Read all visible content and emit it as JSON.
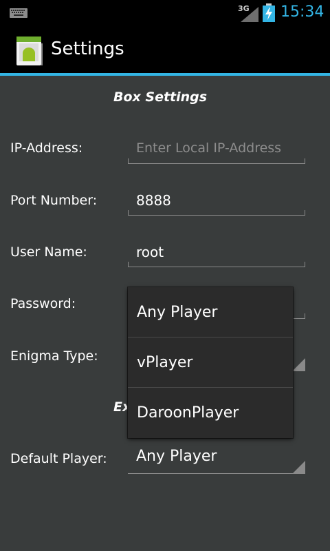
{
  "status_bar": {
    "network": "3G",
    "time": "15:34",
    "icons": [
      "keyboard-icon",
      "signal-icon",
      "battery-charging-icon"
    ]
  },
  "action_bar": {
    "title": "Settings",
    "icon": "android-app-icon"
  },
  "box_settings": {
    "title": "Box Settings",
    "ip_label": "IP-Address:",
    "ip_placeholder": "Enter Local IP-Address",
    "port_label": "Port Number:",
    "port_value": "8888",
    "user_label": "User Name:",
    "user_value": "root",
    "password_label": "Password:",
    "enigma_label": "Enigma Type:"
  },
  "extra_settings": {
    "title_visible": "Ex",
    "default_player_label": "Default Player:",
    "default_player_value": "Any Player"
  },
  "dropdown": {
    "options": [
      "Any Player",
      "vPlayer",
      "DaroonPlayer"
    ]
  },
  "colors": {
    "accent": "#33b5e5",
    "background": "#393c3c",
    "popup_background": "#2b2b2b"
  }
}
